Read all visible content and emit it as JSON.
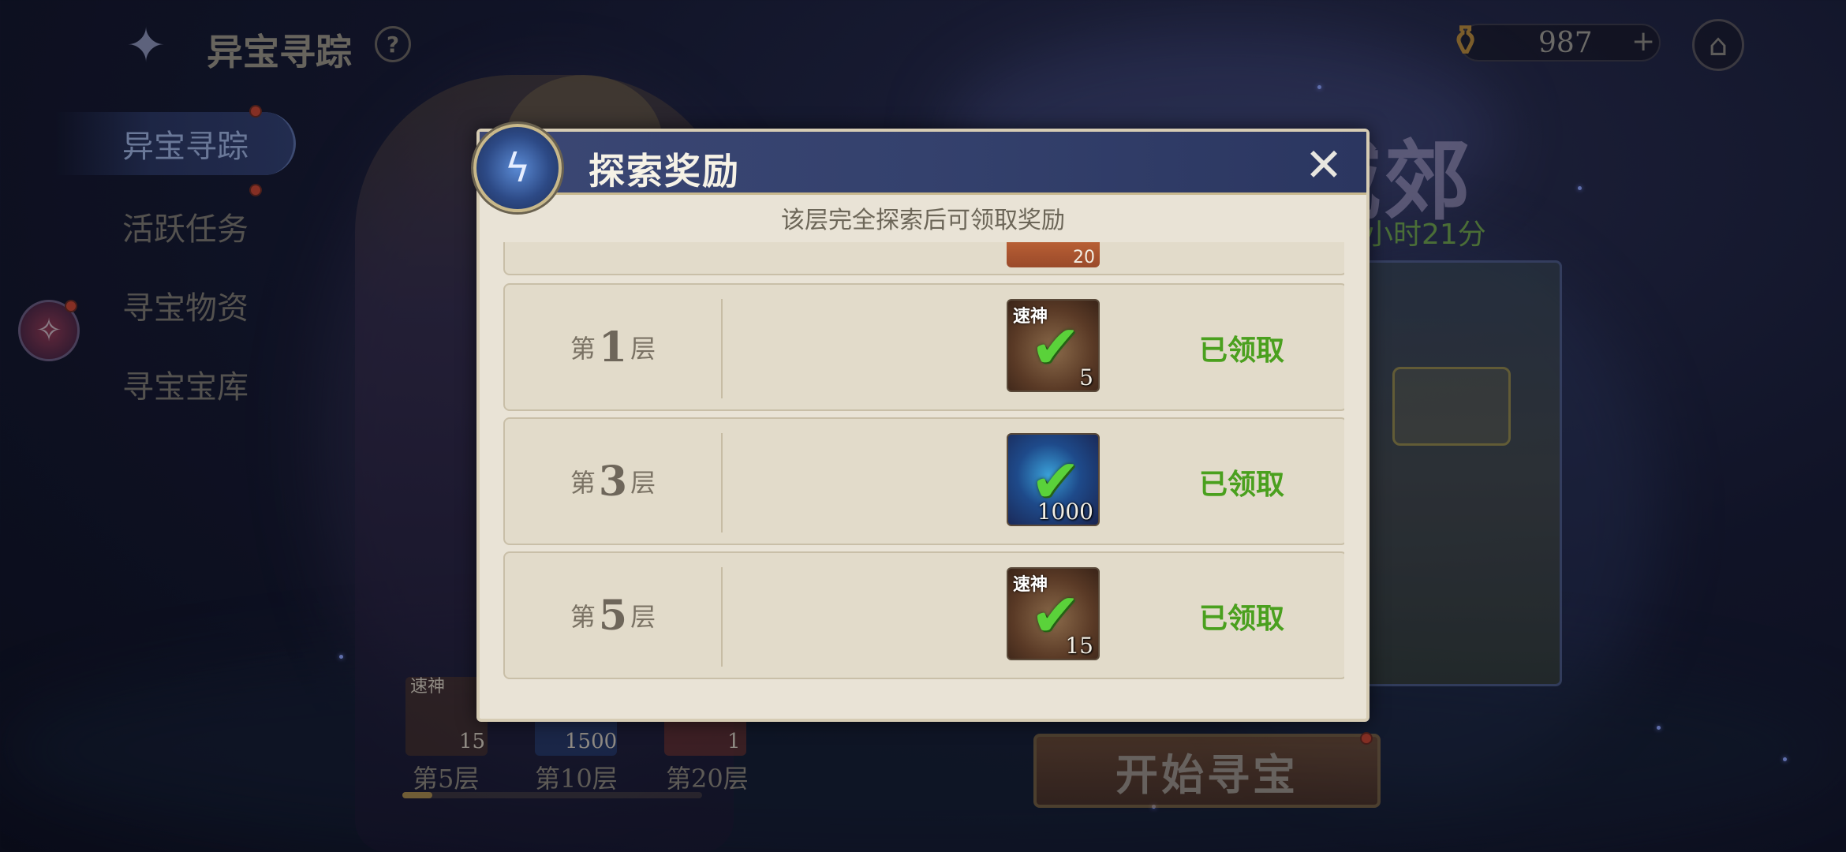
{
  "header": {
    "title": "异宝寻踪",
    "help_label": "?",
    "currency_value": "987",
    "currency_add": "+"
  },
  "sidebar": {
    "items": [
      {
        "label": "异宝寻踪",
        "active": true
      },
      {
        "label": "活跃任务",
        "active": false
      },
      {
        "label": "寻宝物资",
        "active": false
      },
      {
        "label": "寻宝宝库",
        "active": false
      }
    ]
  },
  "background": {
    "title_fragment": "城郊",
    "timer_fragment": "小时21分"
  },
  "bottom": {
    "floors": [
      {
        "label": "第5层",
        "tag": "速神",
        "qty": "15"
      },
      {
        "label": "第10层",
        "qty": "1500"
      },
      {
        "label": "第20层",
        "qty": "1"
      }
    ],
    "progress": 0.1,
    "start_button": "开始寻宝"
  },
  "modal": {
    "title": "探索奖励",
    "close_icon": "close-icon",
    "hint": "该层完全探索后可领取奖励",
    "partial_row_qty": "20",
    "rows": [
      {
        "prefix": "第",
        "num": "1",
        "suffix": "层",
        "item_kind": "chest",
        "item_tag": "速神",
        "qty": "5",
        "status": "已领取"
      },
      {
        "prefix": "第",
        "num": "3",
        "suffix": "层",
        "item_kind": "crystal",
        "item_tag": "",
        "qty": "1000",
        "status": "已领取"
      },
      {
        "prefix": "第",
        "num": "5",
        "suffix": "层",
        "item_kind": "chest",
        "item_tag": "速神",
        "qty": "15",
        "status": "已领取"
      }
    ],
    "colors": {
      "claimed_text": "#4aa01e",
      "check": "#5ad23a",
      "header_bg": "#34416d"
    }
  }
}
